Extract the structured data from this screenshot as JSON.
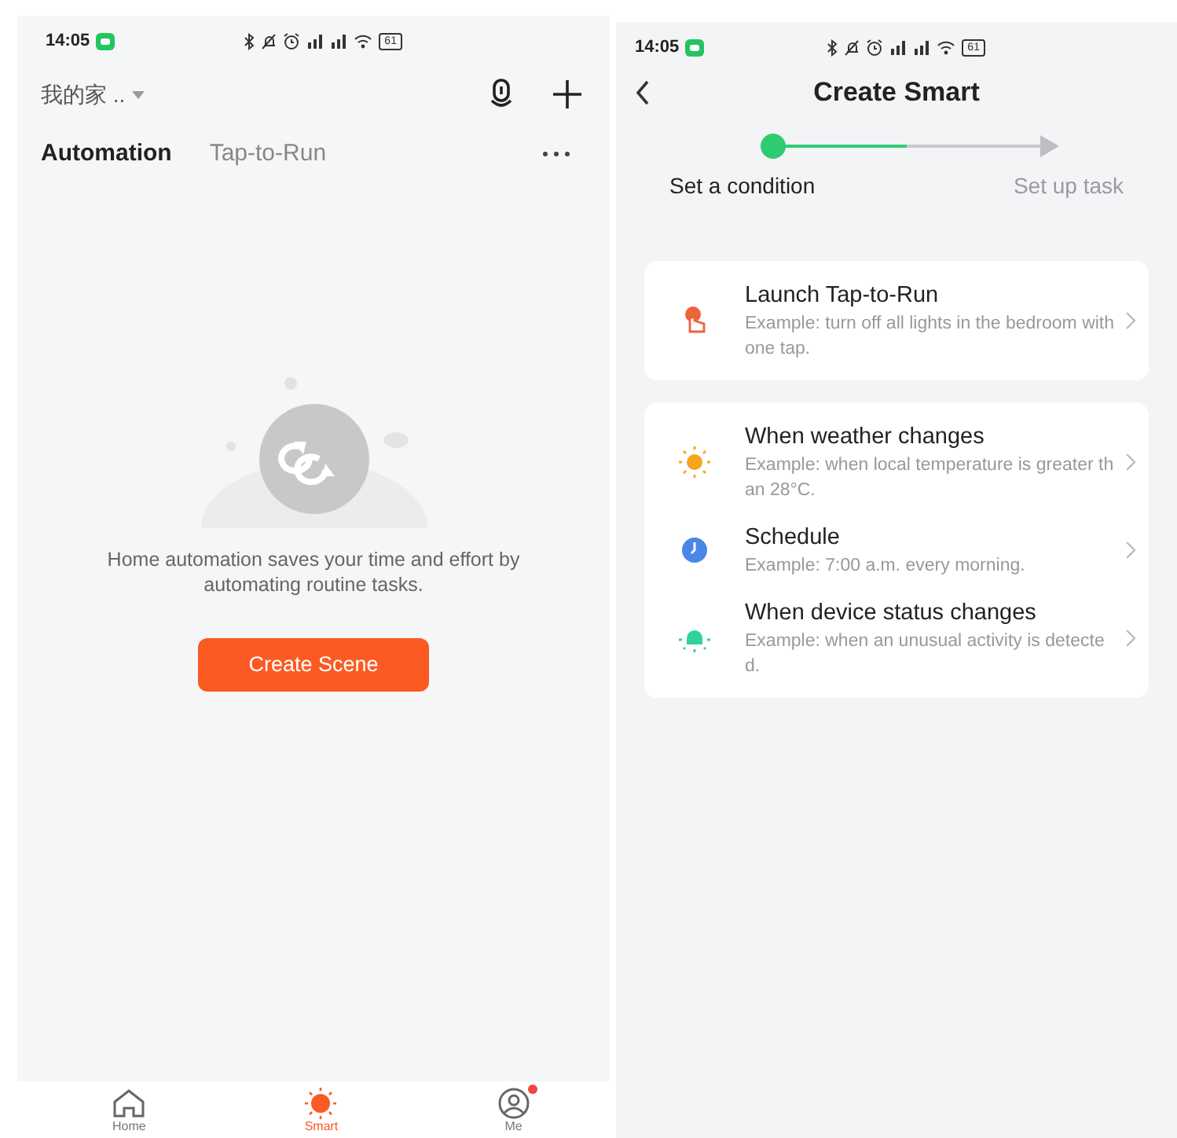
{
  "left_screen": {
    "status_bar": {
      "time": "14:05",
      "battery": "61"
    },
    "home_name": "我的家 ..",
    "tabs": [
      {
        "label": "Automation",
        "selected": true
      },
      {
        "label": "Tap-to-Run",
        "selected": false
      }
    ],
    "empty_state": {
      "message": "Home automation saves your time and effort by automating routine tasks."
    },
    "create_button": "Create Scene",
    "bottom_nav": [
      {
        "kind": "home",
        "label": "Home",
        "selected": false,
        "badge": false
      },
      {
        "kind": "smart",
        "label": "Smart",
        "selected": true,
        "badge": false
      },
      {
        "kind": "me",
        "label": "Me",
        "selected": false,
        "badge": true
      }
    ]
  },
  "right_screen": {
    "status_bar": {
      "time": "14:05",
      "battery": "61"
    },
    "title": "Create Smart",
    "progress": {
      "level": 0.5
    },
    "steps": [
      {
        "label": "Set a condition",
        "active": true
      },
      {
        "label": "Set up task",
        "active": false
      }
    ],
    "cards": [
      {
        "items": [
          {
            "kind": "tap",
            "title": "Launch Tap-to-Run",
            "description": "Example: turn off all lights in the bedroom with one tap."
          }
        ]
      },
      {
        "items": [
          {
            "kind": "weather",
            "title": "When weather changes",
            "description": "Example: when local temperature is greater than 28°C."
          },
          {
            "kind": "schedule",
            "title": "Schedule",
            "description": "Example: 7:00 a.m. every morning."
          },
          {
            "kind": "device",
            "title": "When device status changes",
            "description": "Example: when an unusual activity is detected."
          }
        ]
      }
    ]
  }
}
